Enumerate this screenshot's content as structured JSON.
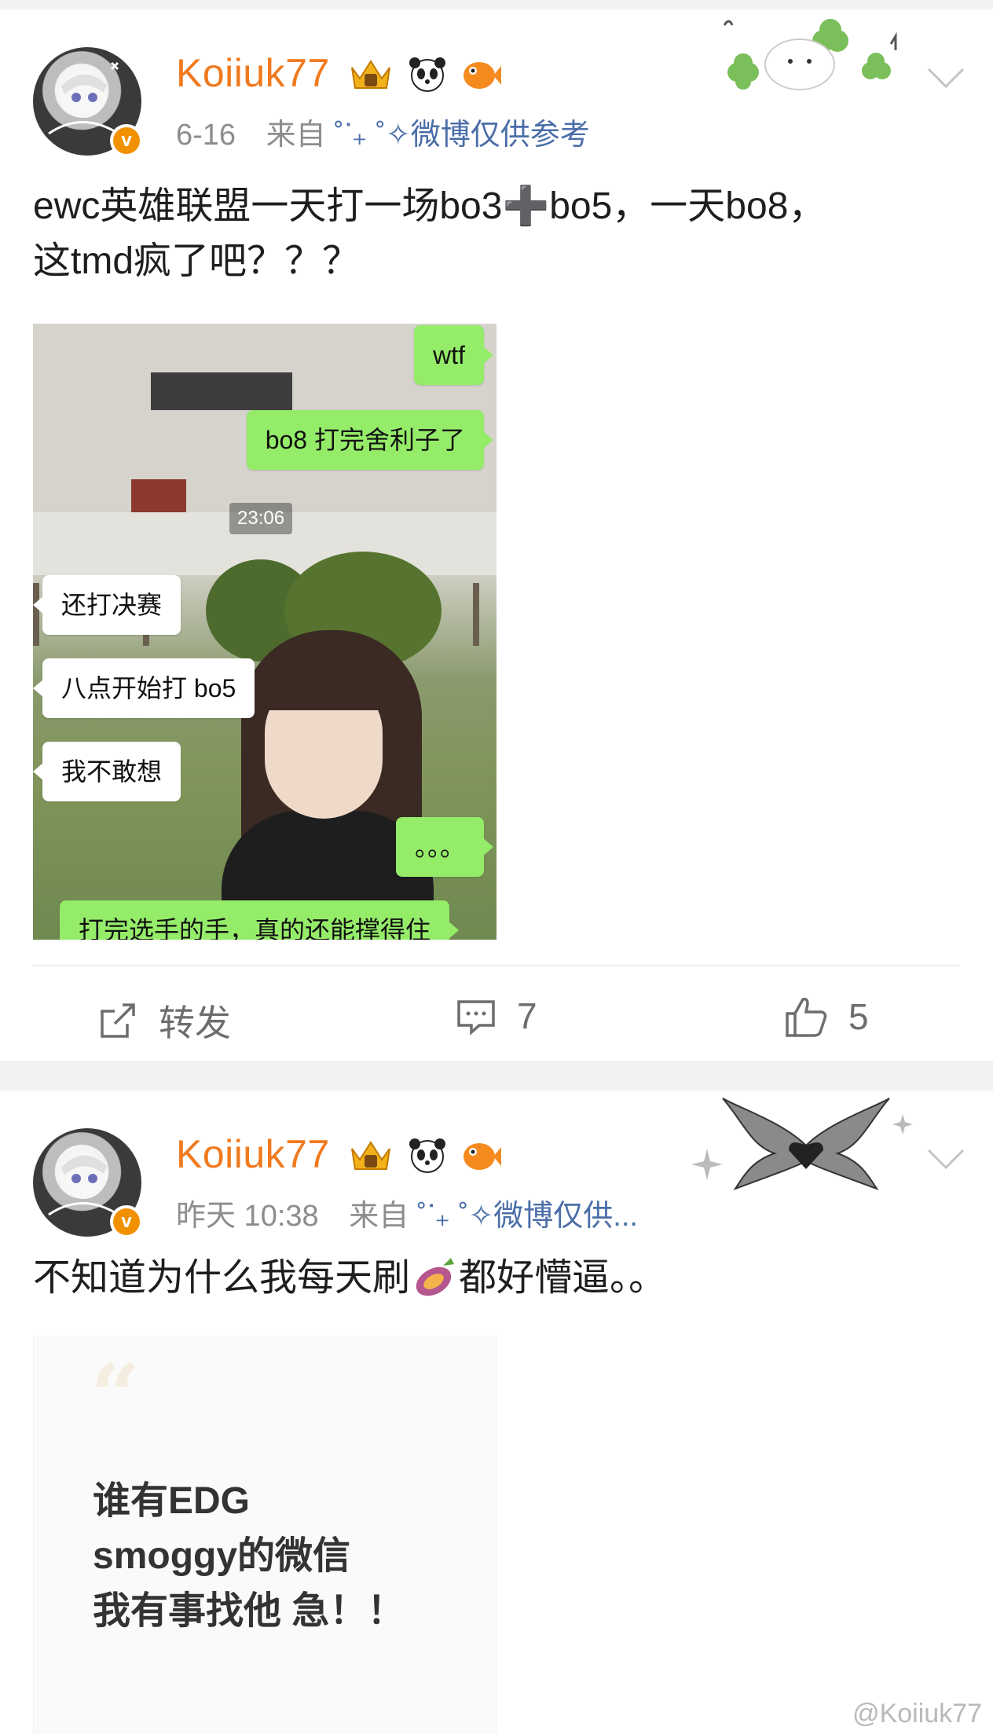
{
  "posts": [
    {
      "username": "Koiiuk77",
      "date": "6-16",
      "from_label": "来自",
      "source": "˚ᐝ₊ ˚✧微博仅供参考",
      "text_line1": "ewc英雄联盟一天打一场bo3➕bo5，一天bo8，",
      "text_line2": "这tmd疯了吧？？？",
      "image": {
        "timestamp": "23:06",
        "messages": [
          {
            "side": "right",
            "text": "wtf"
          },
          {
            "side": "right",
            "text": "bo8 打完舍利子了"
          },
          {
            "side": "left",
            "text": "还打决赛"
          },
          {
            "side": "left",
            "text": "八点开始打 bo5"
          },
          {
            "side": "left",
            "text": "我不敢想"
          },
          {
            "side": "right",
            "text": "。。。"
          },
          {
            "side": "right",
            "text": "打完选手的手，真的还能撑得住"
          }
        ]
      },
      "actions": {
        "repost_label": "转发",
        "comment_count": "7",
        "like_count": "5"
      }
    },
    {
      "username": "Koiiuk77",
      "time": "昨天 10:38",
      "from_label": "来自",
      "source": "˚ᐝ₊ ˚✧微博仅供...",
      "text_before": "不知道为什么我每天刷",
      "text_after": "都好懵逼。。",
      "quote_lines": [
        "谁有EDG",
        "smoggy的微信",
        "我有事找他 急！！"
      ]
    }
  ],
  "watermark": "@Koiiuk77",
  "colors": {
    "username": "#f07a1e",
    "source_link": "#4b6ea8",
    "bubble_green": "#95ec69",
    "verified_badge": "#f29100"
  }
}
